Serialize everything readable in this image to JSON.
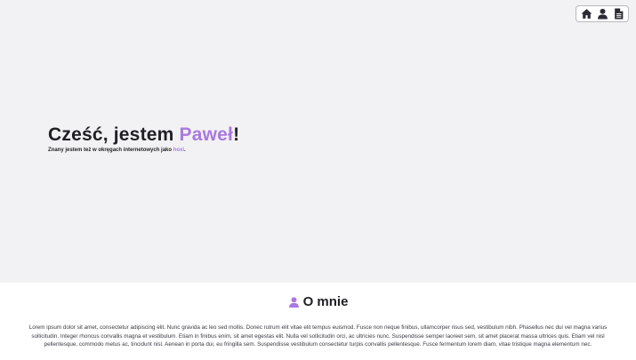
{
  "colors": {
    "accent": "#a979e0",
    "hero_background": "#f2f2f4",
    "about_background": "#ffffff",
    "text": "#1f1f24"
  },
  "nav": {
    "items": [
      {
        "icon": "home-icon"
      },
      {
        "icon": "user-icon"
      },
      {
        "icon": "document-icon"
      }
    ]
  },
  "hero": {
    "greeting": "Cześć, jestem ",
    "name": "Paweł",
    "exclamation": "!",
    "subtitle_prefix": "Znany jestem też w okręgach internetowych jako ",
    "nickname": "hoxi",
    "subtitle_suffix": "."
  },
  "about": {
    "icon": "user-icon",
    "title": "O mnie",
    "text": "Lorem ipsum dolor sit amet, consectetur adipiscing elit. Nunc gravida ac leo sed mollis. Donec rutrum elit vitae elit tempus euismod. Fusce non neque finibus, ullamcorper risus sed, vestibulum nibh. Phasellus nec dui vel magna varius sollicitudin. Integer rhoncus convallis magna et vestibulum. Etiam in finibus enim, sit amet egestas elit. Nulla vel sollicitudin orci, ac ultricies nunc. Suspendisse semper laoreet sem, sit amet placerat massa ultrices quis. Etiam vel nisl pellentesque, commodo metus ac, tincidunt nisl. Aenean in porta dui, eu fringilla sem. Suspendisse vestibulum consectetur turpis convallis pellentesque. Fusce fermentum lorem diam, vitae tristique magna elementum nec."
  }
}
